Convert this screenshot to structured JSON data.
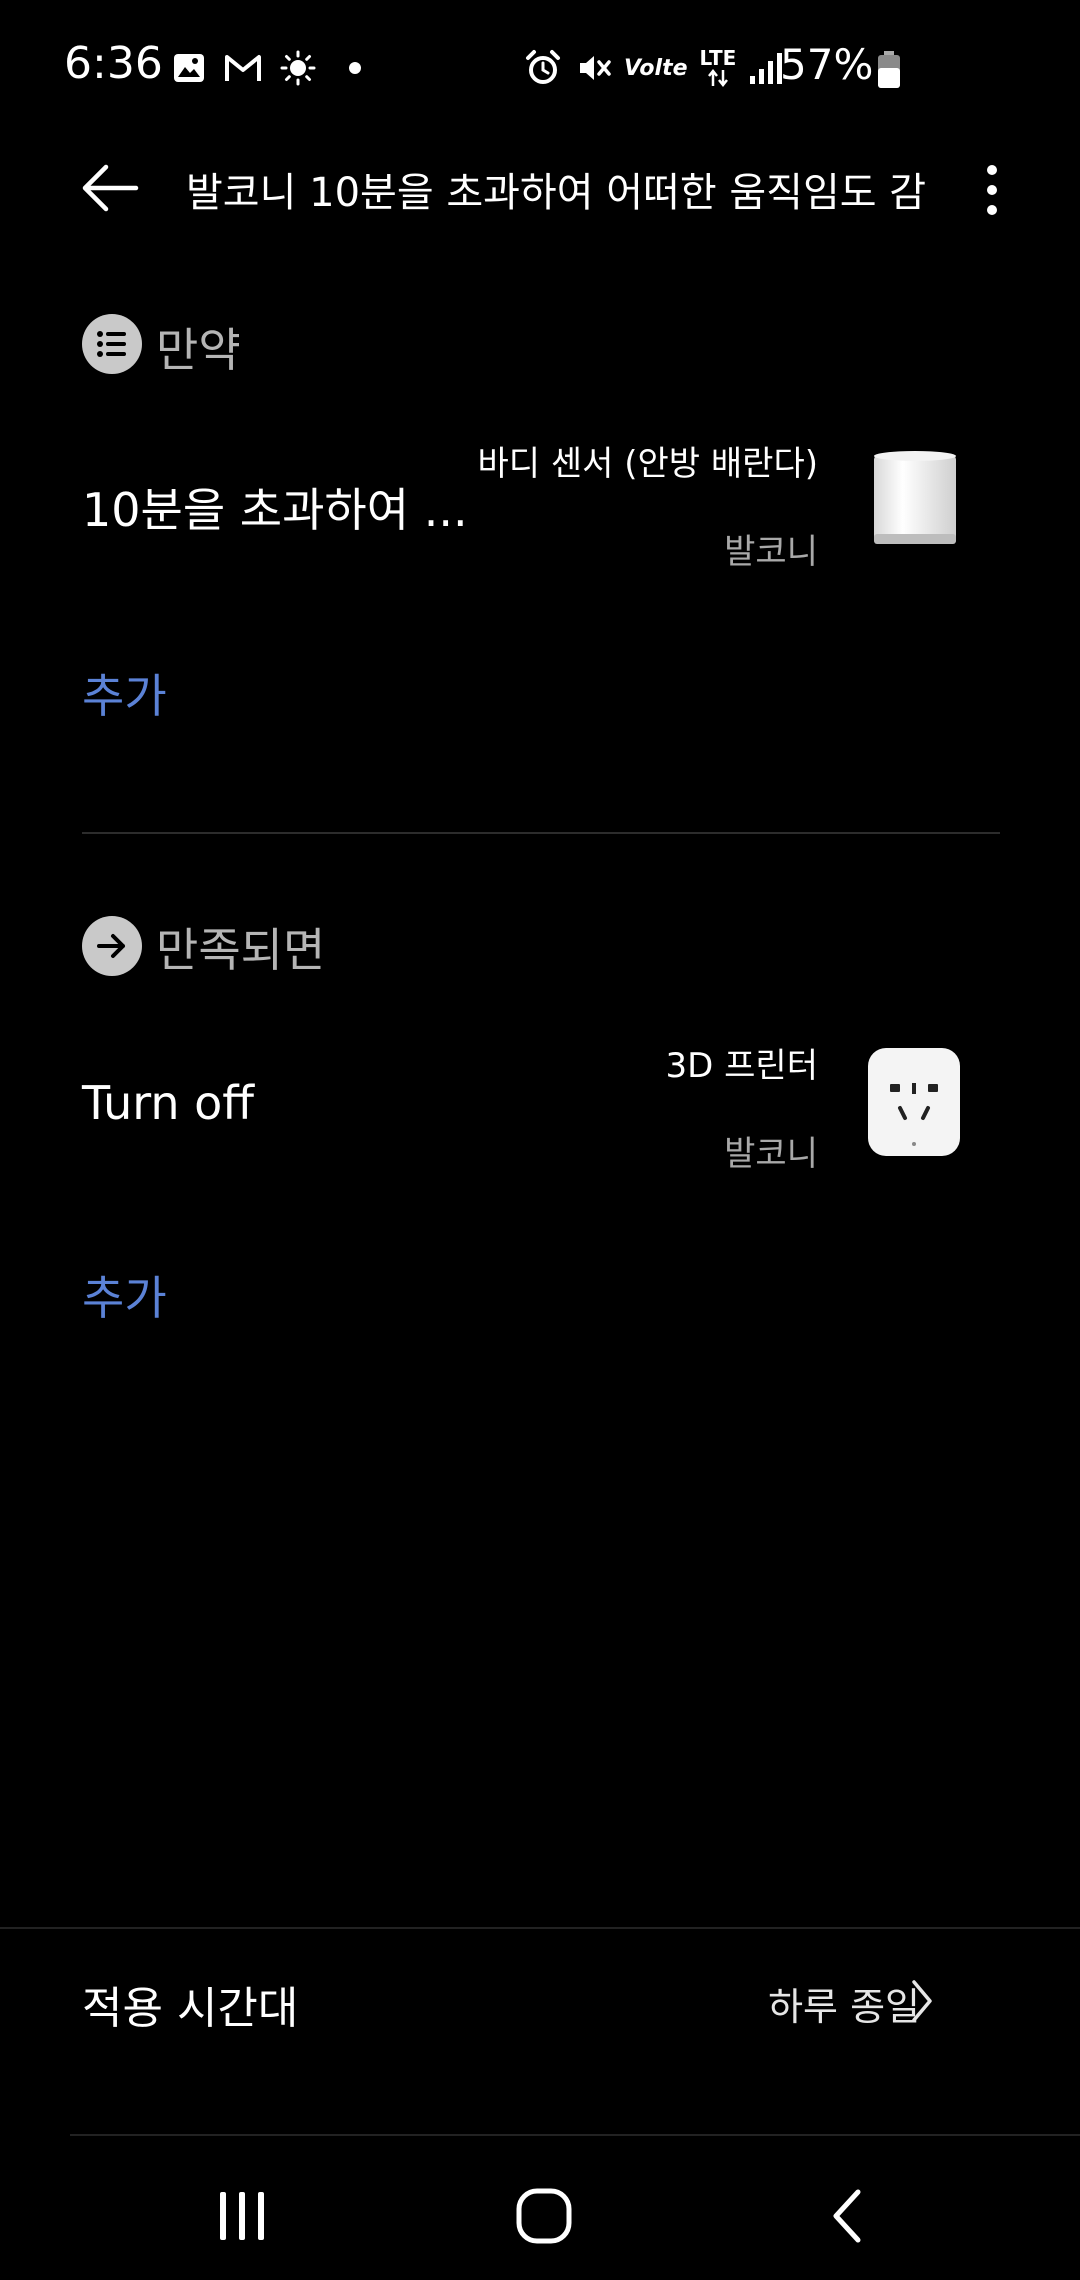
{
  "status_bar": {
    "time": "6:36",
    "battery_percent": "57%",
    "icons_left": [
      "gallery-icon",
      "gmail-icon",
      "brightness-icon",
      "dot-icon"
    ],
    "icons_right": [
      "alarm-icon",
      "mute-icon",
      "volte-icon",
      "lte-icon",
      "signal-icon",
      "battery-icon"
    ],
    "volte_text": "Volte",
    "lte_text": "LTE"
  },
  "header": {
    "title": "발코니 10분을 초과하여 어떠한 움직임도 감..."
  },
  "if_section": {
    "label": "만약",
    "condition": {
      "text": "10분을 초과하여 ...",
      "device_name": "바디 센서 (안방 배란다)",
      "room": "발코니"
    },
    "add_label": "추가"
  },
  "then_section": {
    "label": "만족되면",
    "action": {
      "text": "Turn off",
      "device_name": "3D 프린터",
      "room": "발코니"
    },
    "add_label": "추가"
  },
  "time_period": {
    "label": "적용 시간대",
    "value": "하루 종일"
  },
  "colors": {
    "background": "#000000",
    "accent": "#5b82d6",
    "secondary_text": "#a9a9a9"
  }
}
